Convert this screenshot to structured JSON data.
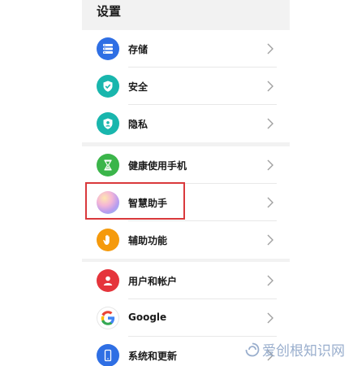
{
  "page": {
    "title": "设置"
  },
  "groups": [
    {
      "items": [
        {
          "label": "存储",
          "icon": "storage-icon",
          "color": "#2f6fe4"
        },
        {
          "label": "安全",
          "icon": "shield-check-icon",
          "color": "#19b6ad"
        },
        {
          "label": "隐私",
          "icon": "privacy-icon",
          "color": "#19b6ad"
        }
      ]
    },
    {
      "items": [
        {
          "label": "健康使用手机",
          "icon": "hourglass-icon",
          "color": "#3bb54a"
        },
        {
          "label": "智慧助手",
          "icon": "smart-assistant-icon",
          "color": "#c9a0f0"
        },
        {
          "label": "辅助功能",
          "icon": "hand-icon",
          "color": "#f59a0c"
        }
      ]
    },
    {
      "items": [
        {
          "label": "用户和帐户",
          "icon": "user-icon",
          "color": "#e5343b"
        },
        {
          "label": "Google",
          "icon": "google-icon",
          "color": "#ffffff"
        },
        {
          "label": "系统和更新",
          "icon": "phone-update-icon",
          "color": "#2f6fe4"
        }
      ]
    }
  ],
  "highlight_color": "#d9393c",
  "watermark": {
    "text": "爱创根知识网"
  }
}
